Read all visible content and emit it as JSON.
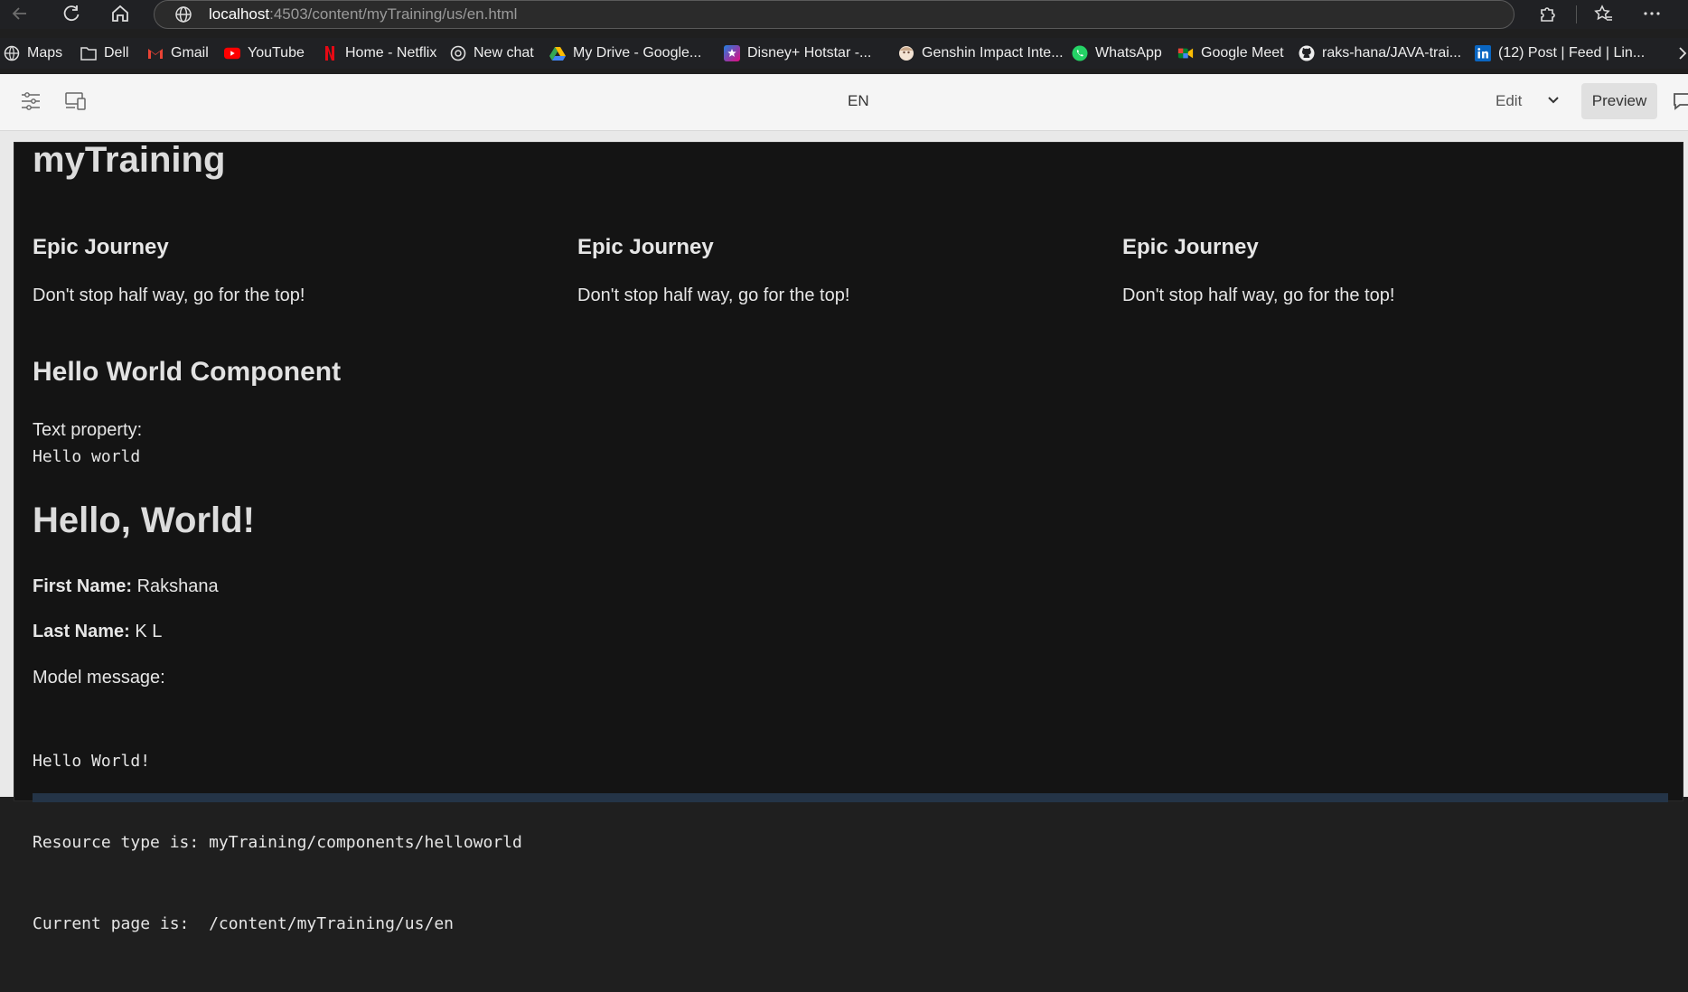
{
  "browser": {
    "url_host": "localhost",
    "url_rest": ":4503/content/myTraining/us/en.html"
  },
  "bookmarks": [
    {
      "label": "Maps",
      "icon": "maps-icon"
    },
    {
      "label": "Dell",
      "icon": "folder-icon"
    },
    {
      "label": "Gmail",
      "icon": "gmail-icon"
    },
    {
      "label": "YouTube",
      "icon": "youtube-icon"
    },
    {
      "label": "Home - Netflix",
      "icon": "netflix-icon"
    },
    {
      "label": "New chat",
      "icon": "chatgpt-icon"
    },
    {
      "label": "My Drive - Google...",
      "icon": "google-drive-icon"
    },
    {
      "label": "Disney+ Hotstar -...",
      "icon": "hotstar-icon"
    },
    {
      "label": "Genshin Impact Inte...",
      "icon": "genshin-icon"
    },
    {
      "label": "WhatsApp",
      "icon": "whatsapp-icon"
    },
    {
      "label": "Google Meet",
      "icon": "google-meet-icon"
    },
    {
      "label": "raks-hana/JAVA-trai...",
      "icon": "github-icon"
    },
    {
      "label": "(12) Post | Feed | Lin...",
      "icon": "linkedin-icon"
    }
  ],
  "editor": {
    "language": "EN",
    "mode": "Edit",
    "preview_label": "Preview"
  },
  "page": {
    "site_title": "myTraining",
    "teasers": [
      {
        "title": "Epic Journey",
        "text": "Don't stop half way, go for the top!"
      },
      {
        "title": "Epic Journey",
        "text": "Don't stop half way, go for the top!"
      },
      {
        "title": "Epic Journey",
        "text": "Don't stop half way, go for the top!"
      }
    ],
    "hello_component": {
      "title": "Hello World Component",
      "text_property_label": "Text property:",
      "text_property_value": "Hello world"
    },
    "hello_heading": "Hello, World!",
    "first_name_label": "First Name:",
    "first_name": "Rakshana",
    "last_name_label": "Last Name:",
    "last_name": "K L",
    "model_message_label": "Model message:",
    "model_lines": [
      "Hello World!",
      "Resource type is: myTraining/components/helloworld",
      "Current page is:  /content/myTraining/us/en"
    ]
  },
  "colors": {
    "page_background": "#141414",
    "browser_chrome": "#202124",
    "editor_bar": "#f5f5f5"
  }
}
